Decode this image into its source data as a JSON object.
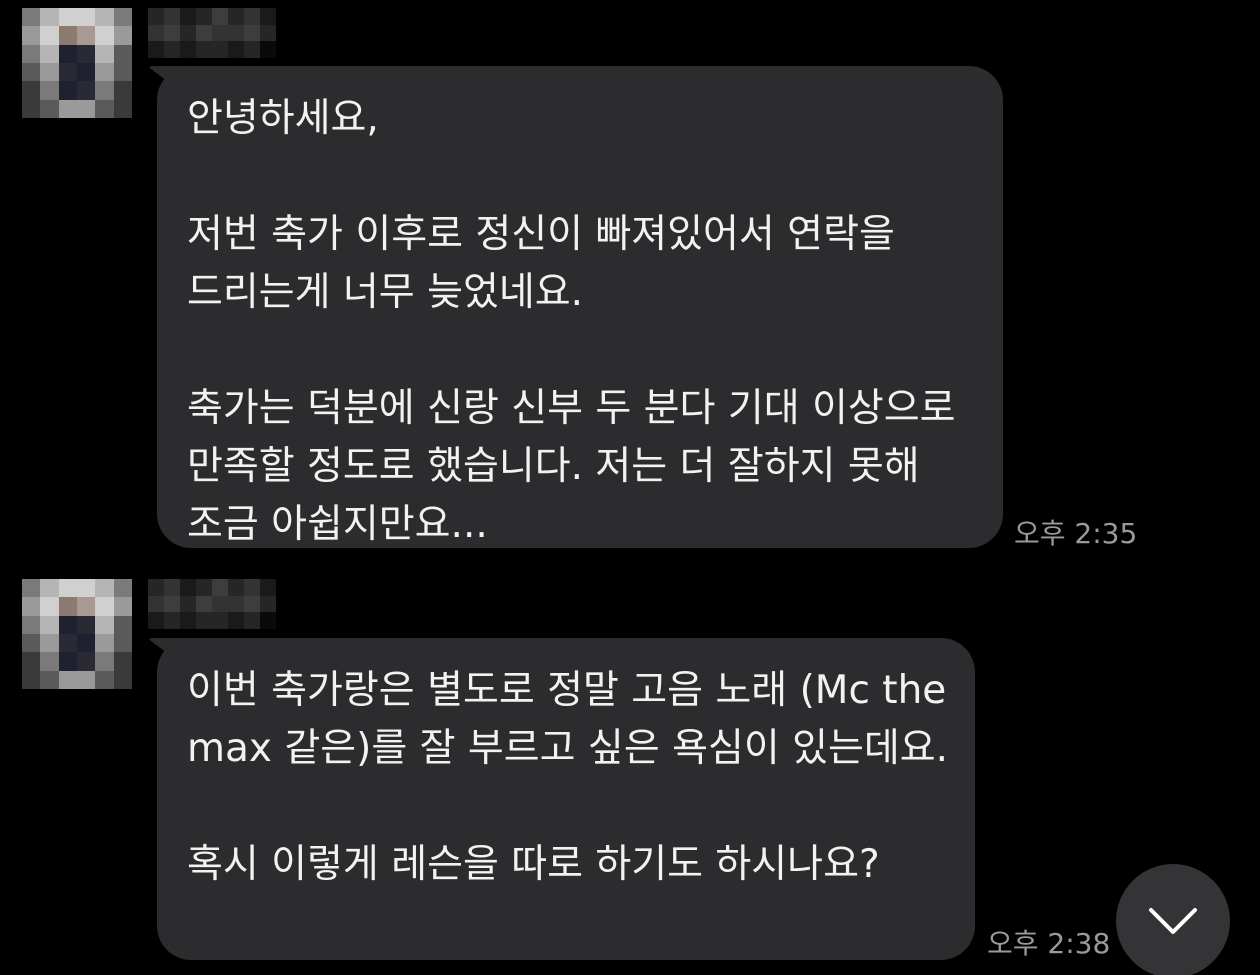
{
  "messages": [
    {
      "text": "안녕하세요,\n\n저번 축가 이후로 정신이 빠져있어서 연락을 드리는게 너무 늦었네요.\n\n축가는 덕분에 신랑 신부 두 분다 기대 이상으로 만족할 정도로 했습니다. 저는 더 잘하지 못해 조금 아쉽지만요...",
      "time": "오후 2:35"
    },
    {
      "text": "이번 축가랑은 별도로 정말 고음 노래 (Mc the max 같은)를 잘 부르고 싶은 욕심이 있는데요.\n\n혹시 이렇게 레슨을 따로 하기도 하시나요?",
      "time": "오후 2:38"
    }
  ],
  "scroll_button": {
    "icon": "chevron-down-icon"
  },
  "colors": {
    "background": "#000000",
    "bubble": "#2c2c2e",
    "text": "#f2f2f2",
    "timestamp": "#9a9a9a",
    "scroll_button": "#343436"
  }
}
